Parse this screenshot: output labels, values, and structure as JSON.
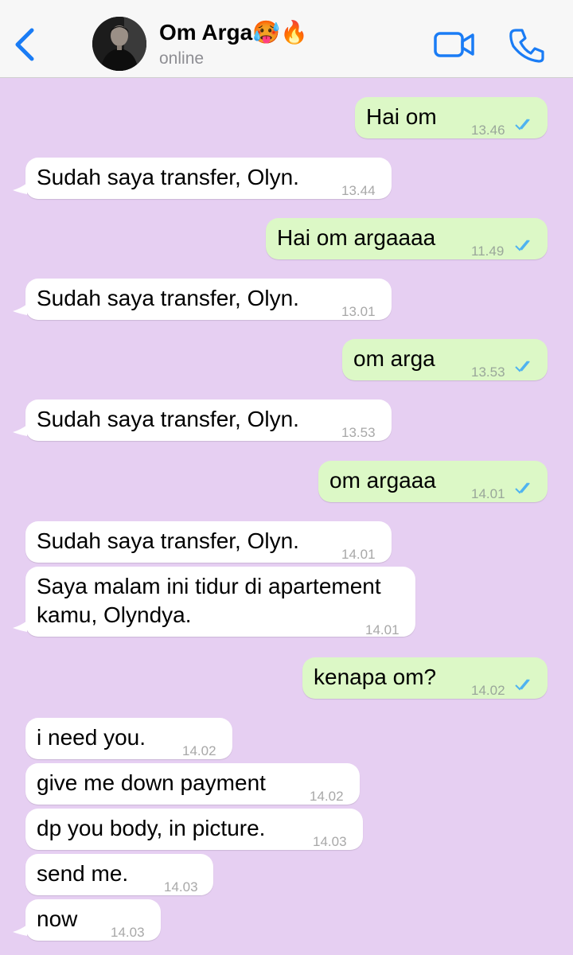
{
  "header": {
    "contact_name": "Om Arga🥵🔥",
    "status": "online"
  },
  "colors": {
    "background": "#e6cff2",
    "incoming_bubble": "#ffffff",
    "outgoing_bubble": "#dcf8c6",
    "accent": "#1a7cf5",
    "read_ticks": "#4fb3f0"
  },
  "icons": [
    "back-chevron-icon",
    "video-call-icon",
    "phone-call-icon",
    "double-check-read-icon"
  ],
  "messages": [
    {
      "direction": "out",
      "text": "Hai om",
      "time": "13.46",
      "read": true
    },
    {
      "direction": "in",
      "text": "Sudah saya transfer, Olyn.",
      "time": "13.44"
    },
    {
      "direction": "out",
      "text": "Hai om argaaaa",
      "time": "11.49",
      "read": true
    },
    {
      "direction": "in",
      "text": "Sudah saya transfer, Olyn.",
      "time": "13.01"
    },
    {
      "direction": "out",
      "text": "om arga",
      "time": "13.53",
      "read": true
    },
    {
      "direction": "in",
      "text": "Sudah saya transfer, Olyn.",
      "time": "13.53"
    },
    {
      "direction": "out",
      "text": "om argaaa",
      "time": "14.01",
      "read": true
    },
    {
      "direction": "in",
      "text": "Sudah saya transfer, Olyn.",
      "time": "14.01"
    },
    {
      "direction": "in",
      "text": "Saya malam ini tidur di apartement\nkamu, Olyndya.",
      "time": "14.01"
    },
    {
      "direction": "out",
      "text": "kenapa om?",
      "time": "14.02",
      "read": true
    },
    {
      "direction": "in",
      "text": "i need you.",
      "time": "14.02"
    },
    {
      "direction": "in",
      "text": "give me down payment",
      "time": "14.02"
    },
    {
      "direction": "in",
      "text": "dp you body, in picture.",
      "time": "14.03"
    },
    {
      "direction": "in",
      "text": "send me.",
      "time": "14.03"
    },
    {
      "direction": "in",
      "text": "now",
      "time": "14.03"
    }
  ]
}
